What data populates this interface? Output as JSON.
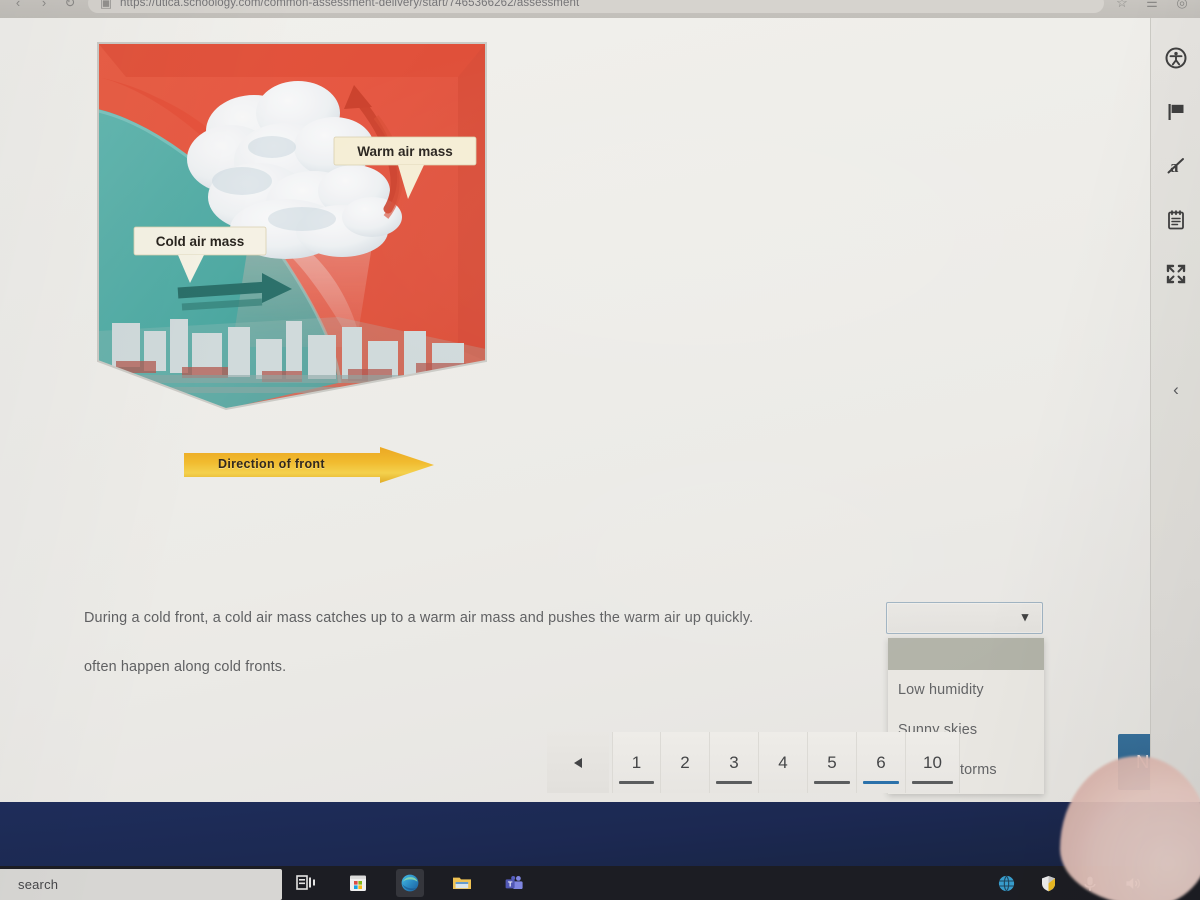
{
  "browser": {
    "url": "https://utica.schoology.com/common-assessment-delivery/start/7465366262/assessment",
    "back_icon": "back-arrow-icon",
    "forward_icon": "forward-arrow-icon",
    "refresh_icon": "refresh-icon",
    "shield_icon": "tracking-protection-icon",
    "favorite_icon": "favorite-star-icon",
    "collections_icon": "collections-icon",
    "profile_icon": "profile-icon"
  },
  "figure": {
    "alt": "cold-front-diagram",
    "warm_label": "Warm air mass",
    "cold_label": "Cold air mass",
    "direction_label": "Direction of front"
  },
  "question": {
    "line1": "During a cold front, a cold air mass catches up to a warm air mass and pushes the warm air up quickly.",
    "line2": "often happen along cold fronts."
  },
  "select": {
    "value": "",
    "chevron": "chevron-down-icon",
    "options": [
      {
        "label": "",
        "highlighted": true
      },
      {
        "label": "Low humidity",
        "highlighted": false
      },
      {
        "label": "Sunny skies",
        "highlighted": false
      },
      {
        "label": "Thunderstorms",
        "highlighted": false
      }
    ]
  },
  "pager": {
    "prev_label": "◀",
    "pages": [
      {
        "label": "1",
        "answered": true,
        "current": false
      },
      {
        "label": "2",
        "answered": false,
        "current": false
      },
      {
        "label": "3",
        "answered": true,
        "current": false
      },
      {
        "label": "4",
        "answered": false,
        "current": false
      },
      {
        "label": "5",
        "answered": true,
        "current": false
      },
      {
        "label": "6",
        "answered": false,
        "current": true
      },
      {
        "label": "10",
        "answered": true,
        "current": false
      }
    ],
    "next_label": "Next"
  },
  "tool_rail": {
    "items": [
      {
        "name": "accessibility-icon"
      },
      {
        "name": "flag-icon"
      },
      {
        "name": "answer-eliminator-icon"
      },
      {
        "name": "notepad-icon"
      },
      {
        "name": "fullscreen-icon"
      }
    ],
    "collapse": "‹"
  },
  "taskbar": {
    "search_placeholder": "search",
    "search_icon": "search-icon",
    "apps": [
      {
        "name": "task-view-icon"
      },
      {
        "name": "microsoft-store-icon"
      },
      {
        "name": "edge-browser-icon"
      },
      {
        "name": "file-explorer-icon"
      },
      {
        "name": "microsoft-teams-icon"
      }
    ],
    "tray": [
      {
        "name": "network-globe-icon"
      },
      {
        "name": "windows-security-shield-icon"
      },
      {
        "name": "microphone-icon"
      },
      {
        "name": "volume-icon"
      }
    ]
  },
  "colors": {
    "accent_blue": "#2b6d9e",
    "current_page_underline": "#1e6fb0",
    "answered_underline": "#56585a",
    "warm_mass": "#ef4b32",
    "cold_mass": "#3fa8a0",
    "direction_arrow": "#f0a81a",
    "page_bg": "#f1efeb",
    "taskbar_bg": "#14151c",
    "desktop_bg": "#15265a"
  }
}
